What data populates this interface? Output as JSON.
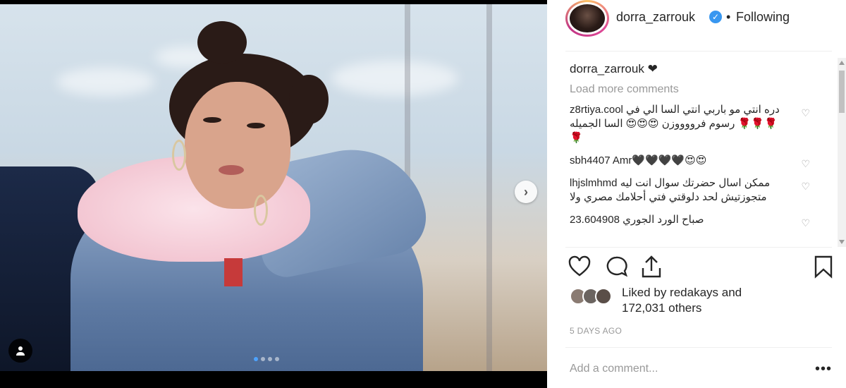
{
  "post": {
    "image_alt": "Woman in denim jacket with pink fur collar",
    "carousel_dots": 4,
    "active_dot": 0
  },
  "header": {
    "username": "dorra_zarrouk",
    "separator": "•",
    "follow_status": "Following"
  },
  "caption": {
    "username": "dorra_zarrouk",
    "text": "❤"
  },
  "load_more": "Load more comments",
  "comments": [
    {
      "user": "z8rtiya.cool",
      "text": "دره انتي مو باربي انتي السا الي في رسوم فرووووزن 😍😍😍 السا الجميله 🌹🌹🌹🌹"
    },
    {
      "user": "sbh4407",
      "text": "Amr🖤🖤🖤🖤😍😍"
    },
    {
      "user": "lhjslmhmd",
      "text": "ممكن اسال حضرتك سوال انت ليه متجوزتيش لحد دلوقتي فتي أحلامك مصري ولا"
    },
    {
      "user": "23.604908",
      "text": "صباح الورد الجوري"
    }
  ],
  "likes": {
    "line1": "Liked by redakays and",
    "line2": "172,031 others"
  },
  "timestamp": "5 DAYS AGO",
  "add_comment_placeholder": "Add a comment...",
  "more_options": "•••",
  "colors": {
    "verified": "#3897f0",
    "text": "#262626",
    "muted": "#999999",
    "carousel_active": "#4da3ff"
  },
  "icons": [
    "next-arrow-icon",
    "user-tag-icon",
    "verified-icon",
    "heart-icon",
    "comment-icon",
    "share-icon",
    "bookmark-icon",
    "more-options-icon"
  ]
}
